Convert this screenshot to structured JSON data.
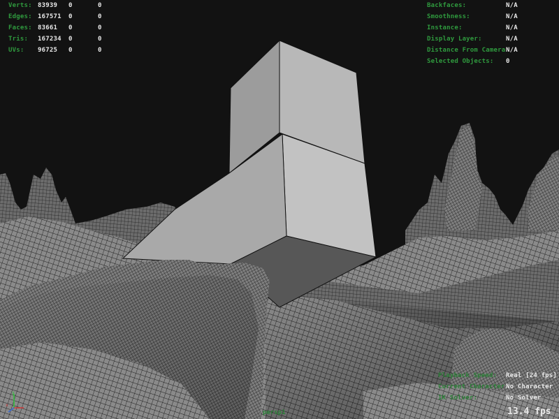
{
  "stats": {
    "rows": [
      {
        "label": "Verts:",
        "total": "83939",
        "selected": "0",
        "components": "0"
      },
      {
        "label": "Edges:",
        "total": "167571",
        "selected": "0",
        "components": "0"
      },
      {
        "label": "Faces:",
        "total": "83661",
        "selected": "0",
        "components": "0"
      },
      {
        "label": "Tris:",
        "total": "167234",
        "selected": "0",
        "components": "0"
      },
      {
        "label": "UVs:",
        "total": "96725",
        "selected": "0",
        "components": "0"
      }
    ]
  },
  "object_info": {
    "rows": [
      {
        "label": "Backfaces:",
        "value": "N/A"
      },
      {
        "label": "Smoothness:",
        "value": "N/A"
      },
      {
        "label": "Instance:",
        "value": "N/A"
      },
      {
        "label": "Display Layer:",
        "value": "N/A"
      },
      {
        "label": "Distance From Camera:",
        "value": "N/A"
      },
      {
        "label": "Selected Objects:",
        "value": "0"
      }
    ]
  },
  "playback": {
    "rows": [
      {
        "label": "Playback Speed:",
        "value": "Real [24 fps]"
      },
      {
        "label": "Current Character:",
        "value": "No Character"
      },
      {
        "label": "IK Solver:",
        "value": "No Solver"
      }
    ],
    "fps": "13.4 fps"
  },
  "camera": {
    "name": "persp1"
  },
  "colors": {
    "hud_label": "#2f9a3e",
    "hud_value": "#e8e8e8",
    "background": "#121212",
    "mesh": "#8f8f8f",
    "wire": "#1c1c1c"
  },
  "icons": {
    "axis": "axis-gizmo-icon"
  }
}
